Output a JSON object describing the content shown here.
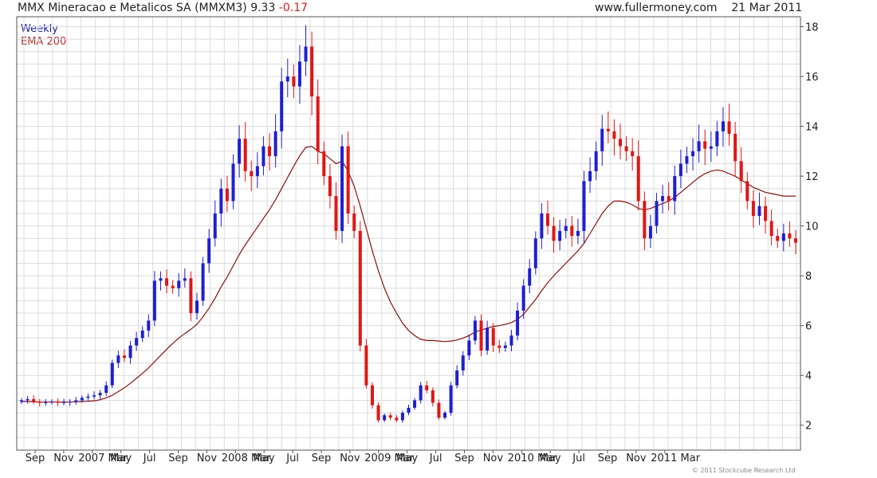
{
  "header": {
    "title": "MMX Mineracao e Metalicos SA (MMXM3)",
    "last": "9.33",
    "change": "-0.17",
    "site": "www.fullermoney.com",
    "date": "21 Mar 2011"
  },
  "legend": {
    "period": "Weekly",
    "indicator": "EMA 200"
  },
  "copyright": "© 2011 Stockcube Research Ltd",
  "chart_data": {
    "type": "candlestick",
    "x_tick_labels": [
      "Sep",
      "Nov",
      "2007",
      "Mar",
      "May",
      "Jul",
      "Sep",
      "Nov",
      "2008",
      "Mar",
      "May",
      "Jul",
      "Sep",
      "Nov",
      "2009",
      "Mar",
      "May",
      "Jul",
      "Sep",
      "Nov",
      "2010",
      "Mar",
      "May",
      "Jul",
      "Sep",
      "Nov",
      "2011",
      "Mar"
    ],
    "y_ticks": [
      2,
      4,
      6,
      8,
      10,
      12,
      14,
      16,
      18
    ],
    "ylim": [
      1,
      18.4
    ],
    "colors": {
      "up": "#1f1fd0",
      "down": "#e01616",
      "ema": "#8b1010",
      "grid": "#dcdcdc"
    },
    "close": [
      3.0,
      3.05,
      2.95,
      2.9,
      2.92,
      2.95,
      2.9,
      2.92,
      2.95,
      3.0,
      3.1,
      3.15,
      3.2,
      3.3,
      3.6,
      4.5,
      4.8,
      4.7,
      5.2,
      5.5,
      5.8,
      6.2,
      7.8,
      7.9,
      7.6,
      7.5,
      7.8,
      7.9,
      6.5,
      7.0,
      8.5,
      9.5,
      10.5,
      11.5,
      11.0,
      12.5,
      13.5,
      12.2,
      12.0,
      12.4,
      13.2,
      12.8,
      13.8,
      15.8,
      16.0,
      15.6,
      16.6,
      17.2,
      15.2,
      13.0,
      12.0,
      11.2,
      9.8,
      13.2,
      10.5,
      9.8,
      5.2,
      3.6,
      2.8,
      2.2,
      2.4,
      2.3,
      2.2,
      2.5,
      2.7,
      3.0,
      3.6,
      3.4,
      2.9,
      2.3,
      2.5,
      3.6,
      4.2,
      4.8,
      5.4,
      6.2,
      5.0,
      5.9,
      5.2,
      5.1,
      5.2,
      5.6,
      6.6,
      7.6,
      8.3,
      9.5,
      10.5,
      10.0,
      9.4,
      9.8,
      10.0,
      9.6,
      9.8,
      11.8,
      12.2,
      13.0,
      13.9,
      13.8,
      13.5,
      13.2,
      13.0,
      12.8,
      11.0,
      9.5,
      10.0,
      11.0,
      11.2,
      11.0,
      12.0,
      12.5,
      12.8,
      13.0,
      13.4,
      13.1,
      13.2,
      13.8,
      14.2,
      13.7,
      12.6,
      11.8,
      11.0,
      10.4,
      10.8,
      10.2,
      9.6,
      9.4,
      9.7,
      9.5,
      9.33
    ],
    "ema_200": [
      2.95,
      2.95,
      2.94,
      2.93,
      2.93,
      2.93,
      2.93,
      2.93,
      2.93,
      2.94,
      2.95,
      2.96,
      2.98,
      3.02,
      3.1,
      3.2,
      3.35,
      3.5,
      3.68,
      3.88,
      4.08,
      4.3,
      4.55,
      4.8,
      5.05,
      5.28,
      5.5,
      5.68,
      5.85,
      6.05,
      6.35,
      6.7,
      7.1,
      7.55,
      7.95,
      8.4,
      8.85,
      9.25,
      9.6,
      9.95,
      10.3,
      10.65,
      11.05,
      11.5,
      11.95,
      12.4,
      12.82,
      13.15,
      13.2,
      13.0,
      12.9,
      12.7,
      12.5,
      12.6,
      12.2,
      11.6,
      10.8,
      9.9,
      9.0,
      8.2,
      7.5,
      6.95,
      6.5,
      6.1,
      5.8,
      5.6,
      5.45,
      5.4,
      5.4,
      5.38,
      5.36,
      5.38,
      5.42,
      5.5,
      5.6,
      5.75,
      5.82,
      5.9,
      5.96,
      6.0,
      6.05,
      6.12,
      6.25,
      6.45,
      6.75,
      7.05,
      7.4,
      7.72,
      8.0,
      8.25,
      8.5,
      8.75,
      9.0,
      9.3,
      9.7,
      10.1,
      10.5,
      10.8,
      11.0,
      11.0,
      10.95,
      10.85,
      10.7,
      10.65,
      10.7,
      10.8,
      10.9,
      11.0,
      11.15,
      11.35,
      11.55,
      11.75,
      11.95,
      12.1,
      12.2,
      12.25,
      12.2,
      12.1,
      12.0,
      11.85,
      11.7,
      11.55,
      11.45,
      11.35,
      11.3,
      11.25,
      11.2,
      11.2,
      11.2
    ]
  }
}
